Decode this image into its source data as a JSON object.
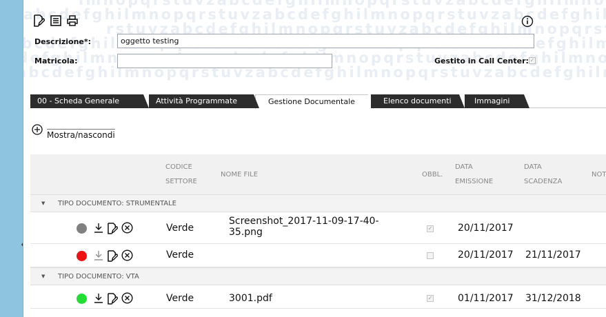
{
  "watermark": {
    "lines": [
      "lmnopqrstuvzabcdefghilmnopqrstuvzabcdefghilmnopqrstuvzabcdefghilmnopqrstuvzab",
      "abcdefghilmnopqrstuvzabcdefghilmnopqrstuvzabcdefghilmnopqrstuvzabcdefghilmnopqrstuvzab",
      "rstuvzabcdefghilmnopqrstuvzabcdefghilmnopqrstuvzabcdefghilmnopqrstuvzab",
      "abcdefghilmnopqrstuvzabcdefghilmnopqrstuvzabcdefghilmnopqrstuvzabcdefghilmnopqrstuvzab",
      "abcdefghilmnopqrstuvzabcdefghilmnopqrstuvzabcdefghilmnopqrstuvzabcdefghilmnopqrstuvzab",
      "abcdefghilmnopqrstuvzabcdefghilmnopqrstuvzabcdefghilmnopqrstuvzabcdefghilmnopqrstuvzab"
    ]
  },
  "toolbar": {
    "icons": [
      "edit-icon",
      "list-icon",
      "print-icon"
    ],
    "info_icon": "info-icon"
  },
  "form": {
    "descrizione_label": "Descrizione*:",
    "descrizione_value": "oggetto testing",
    "matricola_label": "Matricola:",
    "matricola_value": "",
    "call_center_label": "Gestito in Call Center:",
    "call_center_checked": true
  },
  "tabs": [
    {
      "label": "00 - Scheda Generale",
      "active": false
    },
    {
      "label": "Attività Programmate",
      "active": false
    },
    {
      "label": "Gestione Documentale",
      "active": true
    },
    {
      "label": "Elenco documenti",
      "active": false
    },
    {
      "label": "Immagini",
      "active": false
    }
  ],
  "toggle": {
    "label": "Mostra/nascondi",
    "icon": "plus-circle-icon"
  },
  "grid": {
    "headers": {
      "codice_1": "CODICE",
      "codice_2": "SETTORE",
      "nome_file": "NOME FILE",
      "obbl": "OBBL.",
      "emissione_1": "DATA",
      "emissione_2": "EMISSIONE",
      "scadenza_1": "DATA",
      "scadenza_2": "SCADENZA",
      "note": "NOTE"
    },
    "groups": [
      {
        "label": "TIPO DOCUMENTO: STRUMENTALE",
        "rows": [
          {
            "status_color": "#808080",
            "codice": "Verde",
            "nome_file_1": "Screenshot_2017-11-09-17-40-",
            "nome_file_2": "35.png",
            "obbl": true,
            "emissione": "20/11/2017",
            "scadenza": ""
          },
          {
            "status_color": "#ee1111",
            "codice": "Verde",
            "nome_file_1": "",
            "nome_file_2": "",
            "obbl": false,
            "emissione": "20/11/2017",
            "scadenza": "21/11/2017"
          }
        ]
      },
      {
        "label": "TIPO DOCUMENTO: VTA",
        "rows": [
          {
            "status_color": "#22dd33",
            "codice": "Verde",
            "nome_file_1": "3001.pdf",
            "nome_file_2": "",
            "obbl": true,
            "emissione": "01/11/2017",
            "scadenza": "31/12/2018"
          }
        ]
      }
    ],
    "row_icons": [
      "download-icon",
      "edit-icon",
      "delete-icon"
    ]
  }
}
